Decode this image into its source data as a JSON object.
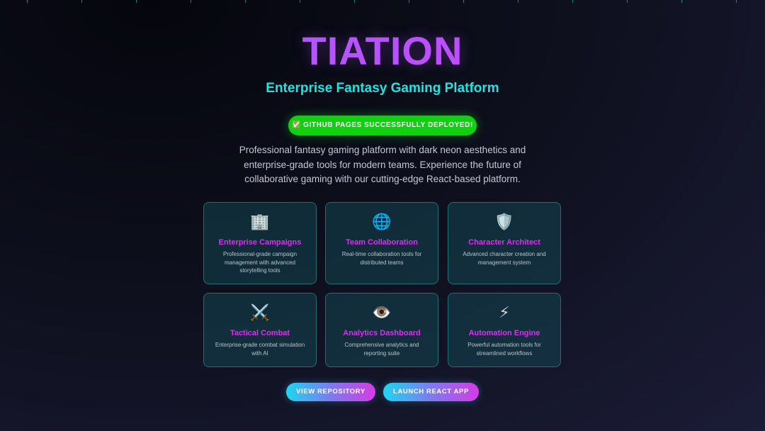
{
  "hero": {
    "brand": "TIATION",
    "subtitle": "Enterprise Fantasy Gaming Platform",
    "badge_icon": "✅",
    "badge": "GITHUB PAGES SUCCESSFULLY DEPLOYED!",
    "description": "Professional fantasy gaming platform with dark neon aesthetics and enterprise-grade tools for modern teams. Experience the future of collaborative gaming with our cutting-edge React-based platform."
  },
  "features": [
    {
      "icon": "🏢",
      "icon_name": "office-building-icon",
      "title": "Enterprise Campaigns",
      "description": "Professional-grade campaign management with advanced storytelling tools"
    },
    {
      "icon": "🌐",
      "icon_name": "globe-icon",
      "title": "Team Collaboration",
      "description": "Real-time collaboration tools for distributed teams"
    },
    {
      "icon": "🛡️",
      "icon_name": "shield-icon",
      "title": "Character Architect",
      "description": "Advanced character creation and management system"
    },
    {
      "icon": "⚔️",
      "icon_name": "crossed-swords-icon",
      "title": "Tactical Combat",
      "description": "Enterprise-grade combat simulation with AI"
    },
    {
      "icon": "👁️",
      "icon_name": "eye-icon",
      "title": "Analytics Dashboard",
      "description": "Comprehensive analytics and reporting suite"
    },
    {
      "icon": "⚡",
      "icon_name": "lightning-icon",
      "title": "Automation Engine",
      "description": "Powerful automation tools for streamlined workflows"
    }
  ],
  "actions": {
    "view_repository": "VIEW REPOSITORY",
    "launch_app": "LAUNCH REACT APP"
  },
  "colors": {
    "accent_cyan": "#22e3e3",
    "accent_magenta": "#d92ef2",
    "success_green": "#10d010",
    "background": "#15162b"
  }
}
